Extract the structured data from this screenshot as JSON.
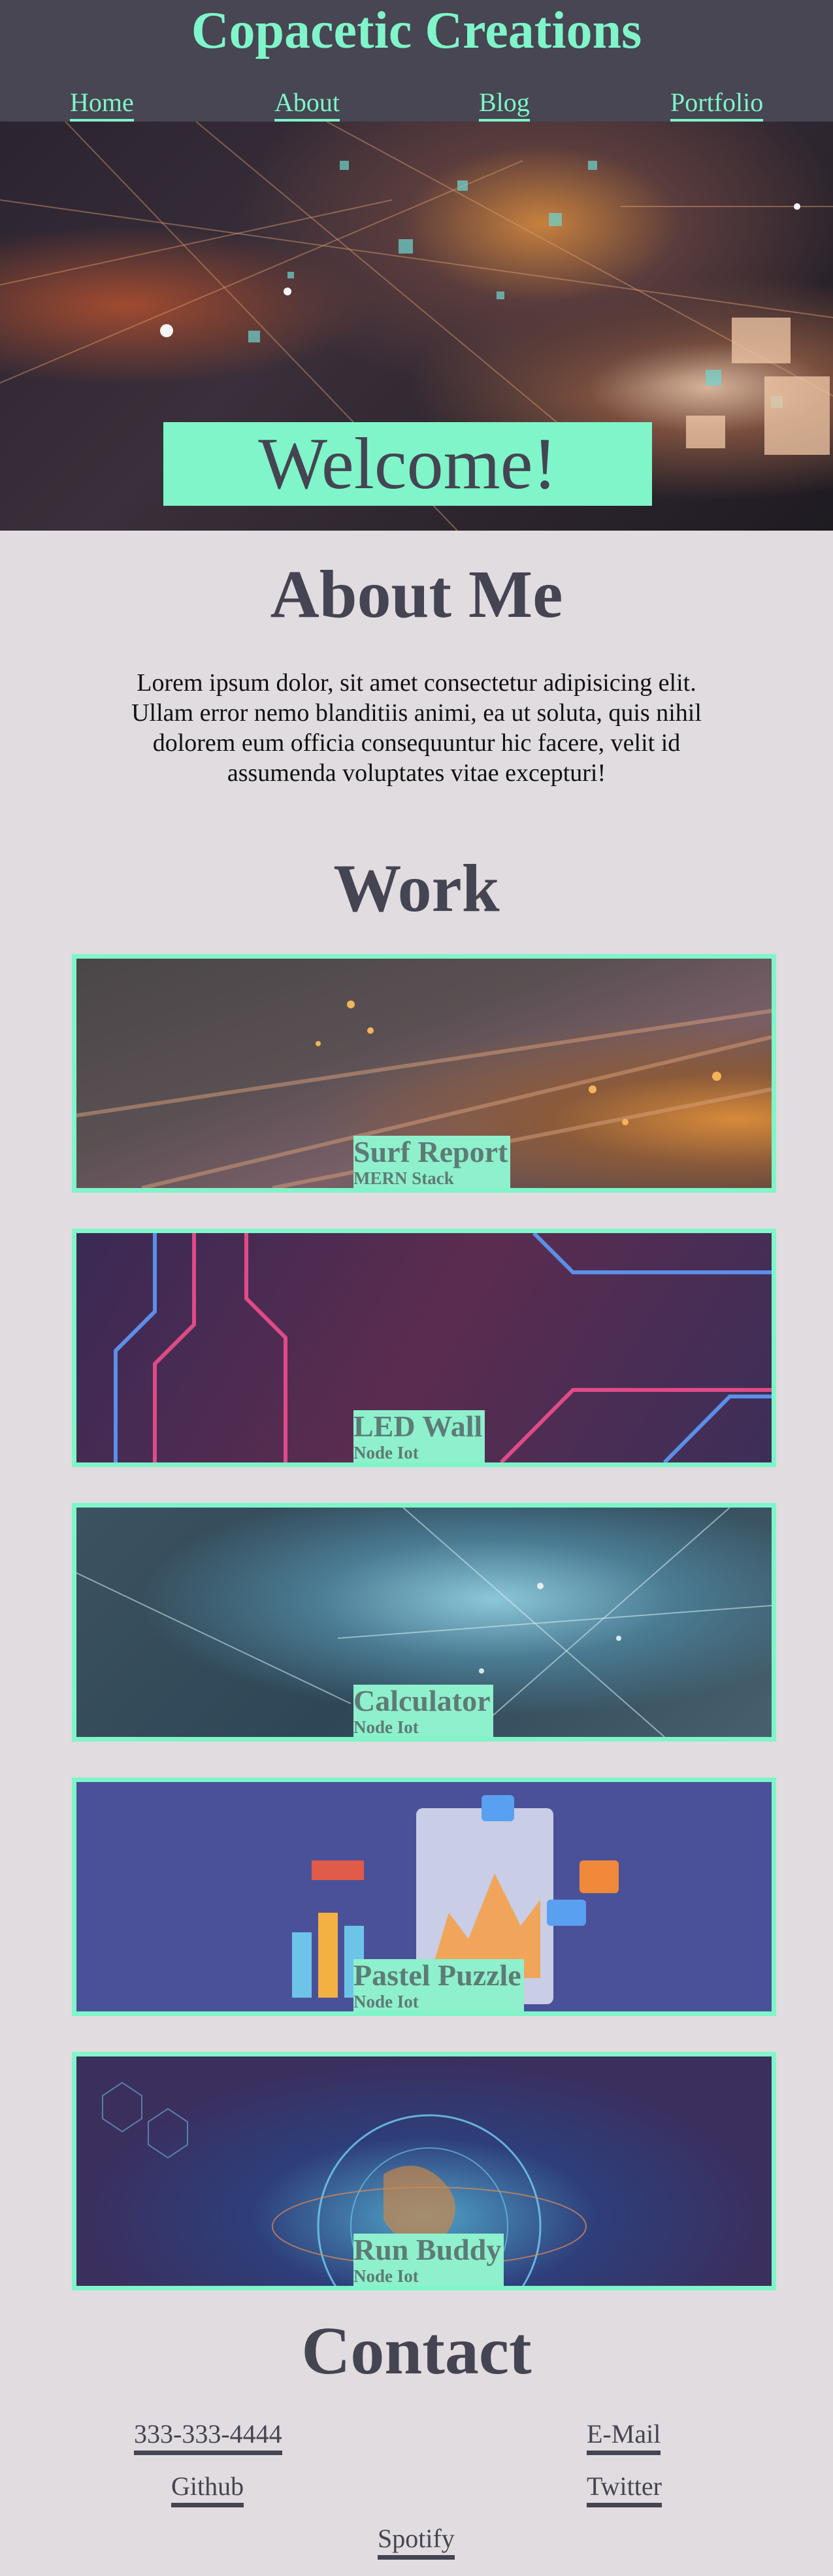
{
  "header": {
    "title": "Copacetic Creations",
    "nav": [
      "Home",
      "About",
      "Blog",
      "Portfolio"
    ]
  },
  "hero": {
    "welcome": "Welcome!"
  },
  "about": {
    "heading": "About Me",
    "text": "Lorem ipsum dolor, sit amet consectetur adipisicing elit. Ullam error nemo blanditiis animi, ea ut soluta, quis nihil dolorem eum officia consequuntur hic facere, velit id assumenda voluptates vitae excepturi!"
  },
  "work": {
    "heading": "Work",
    "projects": [
      {
        "title": "Surf Report",
        "subtitle": "MERN Stack"
      },
      {
        "title": "LED Wall",
        "subtitle": "Node Iot"
      },
      {
        "title": "Calculator",
        "subtitle": "Node Iot"
      },
      {
        "title": "Pastel Puzzle",
        "subtitle": "Node Iot"
      },
      {
        "title": "Run Buddy",
        "subtitle": "Node Iot"
      }
    ]
  },
  "contact": {
    "heading": "Contact",
    "links": [
      "333-333-4444",
      "E-Mail",
      "Github",
      "Twitter",
      "Spotify"
    ]
  },
  "colors": {
    "accent": "#7ff5c9",
    "header_bg": "#474652",
    "page_bg": "#e0dcdf",
    "heading_text": "#454452"
  }
}
